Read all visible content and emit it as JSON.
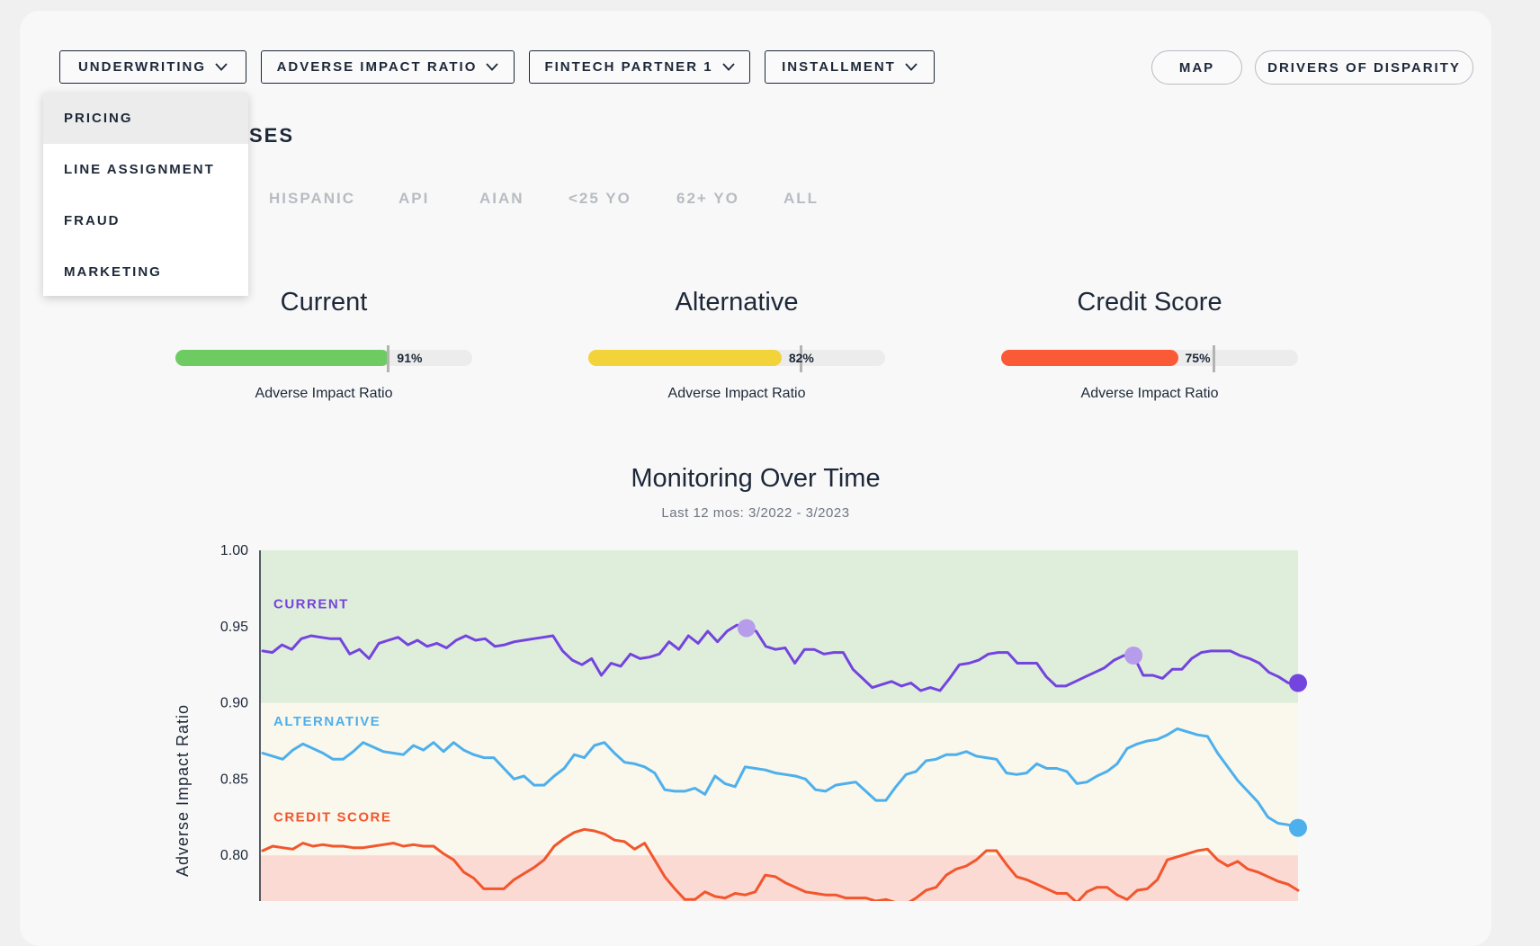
{
  "toolbar": {
    "use_case": "UNDERWRITING",
    "metric": "ADVERSE IMPACT RATIO",
    "partner": "FINTECH PARTNER 1",
    "product": "INSTALLMENT",
    "map_label": "MAP",
    "drivers_label": "DRIVERS OF DISPARITY"
  },
  "menu": {
    "items": [
      "PRICING",
      "LINE ASSIGNMENT",
      "FRAUD",
      "MARKETING"
    ],
    "active": "PRICING"
  },
  "section": {
    "heading_partial": "SES"
  },
  "groups": [
    "HISPANIC",
    "API",
    "AIAN",
    "<25 YO",
    "62+ YO",
    "ALL"
  ],
  "metrics": [
    {
      "title": "Current",
      "value_label": "91%",
      "value": 0.91,
      "sub": "Adverse Impact Ratio",
      "color": "#6ecb62"
    },
    {
      "title": "Alternative",
      "value_label": "82%",
      "value": 0.82,
      "sub": "Adverse Impact Ratio",
      "color": "#f3d33a"
    },
    {
      "title": "Credit Score",
      "value_label": "75%",
      "value": 0.75,
      "sub": "Adverse Impact Ratio",
      "color": "#fa5a35"
    }
  ],
  "chart": {
    "title": "Monitoring Over Time",
    "subtitle": "Last 12 mos: 3/2022 - 3/2023"
  },
  "chart_data": {
    "type": "line",
    "ylabel": "Adverse Impact Ratio",
    "ylim": [
      0.77,
      1.0
    ],
    "yticks": [
      "1.00",
      "0.95",
      "0.90",
      "0.85",
      "0.80"
    ],
    "bands": [
      {
        "from": 0.9,
        "to": 1.0,
        "color": "#dfeedb"
      },
      {
        "from": 0.8,
        "to": 0.9,
        "color": "#faf7ec"
      },
      {
        "from": 0.77,
        "to": 0.8,
        "color": "#fbdad3"
      }
    ],
    "series": [
      {
        "name": "CURRENT",
        "color": "#7444df",
        "values": [
          0.934,
          0.933,
          0.938,
          0.935,
          0.942,
          0.944,
          0.943,
          0.942,
          0.942,
          0.932,
          0.935,
          0.929,
          0.939,
          0.941,
          0.943,
          0.938,
          0.941,
          0.937,
          0.939,
          0.936,
          0.941,
          0.944,
          0.941,
          0.942,
          0.937,
          0.938,
          0.94,
          0.941,
          0.942,
          0.943,
          0.944,
          0.934,
          0.928,
          0.925,
          0.929,
          0.918,
          0.926,
          0.924,
          0.932,
          0.929,
          0.93,
          0.932,
          0.94,
          0.935,
          0.944,
          0.939,
          0.947,
          0.94,
          0.947,
          0.951,
          0.949,
          0.947,
          0.937,
          0.935,
          0.936,
          0.926,
          0.935,
          0.935,
          0.932,
          0.933,
          0.933,
          0.922,
          0.916,
          0.91,
          0.912,
          0.914,
          0.911,
          0.913,
          0.908,
          0.91,
          0.908,
          0.916,
          0.925,
          0.926,
          0.928,
          0.932,
          0.933,
          0.933,
          0.926,
          0.926,
          0.926,
          0.917,
          0.911,
          0.911,
          0.914,
          0.917,
          0.92,
          0.923,
          0.928,
          0.931,
          0.931,
          0.918,
          0.918,
          0.916,
          0.922,
          0.922,
          0.929,
          0.933,
          0.934,
          0.934,
          0.934,
          0.931,
          0.929,
          0.926,
          0.92,
          0.917,
          0.913,
          0.913
        ]
      },
      {
        "name": "ALTERNATIVE",
        "color": "#4db0ec",
        "values": [
          0.867,
          0.865,
          0.863,
          0.869,
          0.873,
          0.87,
          0.867,
          0.863,
          0.863,
          0.868,
          0.874,
          0.871,
          0.868,
          0.867,
          0.866,
          0.872,
          0.869,
          0.874,
          0.868,
          0.874,
          0.869,
          0.866,
          0.864,
          0.864,
          0.857,
          0.85,
          0.852,
          0.846,
          0.846,
          0.852,
          0.857,
          0.866,
          0.864,
          0.872,
          0.874,
          0.867,
          0.861,
          0.86,
          0.858,
          0.854,
          0.843,
          0.842,
          0.842,
          0.844,
          0.84,
          0.852,
          0.847,
          0.845,
          0.858,
          0.857,
          0.856,
          0.854,
          0.853,
          0.852,
          0.85,
          0.843,
          0.842,
          0.846,
          0.847,
          0.848,
          0.842,
          0.836,
          0.836,
          0.845,
          0.853,
          0.855,
          0.862,
          0.863,
          0.866,
          0.866,
          0.868,
          0.865,
          0.864,
          0.863,
          0.854,
          0.853,
          0.854,
          0.86,
          0.857,
          0.857,
          0.855,
          0.847,
          0.848,
          0.852,
          0.855,
          0.86,
          0.87,
          0.873,
          0.875,
          0.876,
          0.879,
          0.883,
          0.881,
          0.879,
          0.878,
          0.867,
          0.858,
          0.849,
          0.842,
          0.835,
          0.825,
          0.821,
          0.82,
          0.818
        ]
      },
      {
        "name": "CREDIT SCORE",
        "color": "#f2562d",
        "values": [
          0.803,
          0.806,
          0.805,
          0.804,
          0.808,
          0.806,
          0.807,
          0.806,
          0.806,
          0.805,
          0.805,
          0.806,
          0.807,
          0.808,
          0.806,
          0.807,
          0.806,
          0.806,
          0.801,
          0.797,
          0.789,
          0.785,
          0.778,
          0.778,
          0.778,
          0.784,
          0.788,
          0.792,
          0.797,
          0.806,
          0.811,
          0.815,
          0.817,
          0.816,
          0.814,
          0.81,
          0.809,
          0.804,
          0.808,
          0.797,
          0.786,
          0.778,
          0.771,
          0.771,
          0.776,
          0.773,
          0.772,
          0.775,
          0.774,
          0.776,
          0.787,
          0.786,
          0.782,
          0.779,
          0.776,
          0.775,
          0.774,
          0.774,
          0.772,
          0.772,
          0.772,
          0.77,
          0.771,
          0.769,
          0.768,
          0.772,
          0.777,
          0.779,
          0.787,
          0.791,
          0.793,
          0.797,
          0.803,
          0.803,
          0.794,
          0.786,
          0.784,
          0.781,
          0.778,
          0.775,
          0.775,
          0.769,
          0.776,
          0.779,
          0.779,
          0.774,
          0.771,
          0.777,
          0.778,
          0.784,
          0.797,
          0.799,
          0.801,
          0.803,
          0.804,
          0.797,
          0.793,
          0.796,
          0.791,
          0.789,
          0.786,
          0.783,
          0.781,
          0.777
        ]
      }
    ],
    "highlights": [
      {
        "series": 0,
        "index": 50,
        "color": "#b69ceb"
      },
      {
        "series": 0,
        "index": 90,
        "color": "#b69ceb"
      },
      {
        "series": 0,
        "index": 107,
        "color": "#7444df"
      },
      {
        "series": 1,
        "index": 103,
        "color": "#4db0ec"
      }
    ],
    "grid": false
  }
}
